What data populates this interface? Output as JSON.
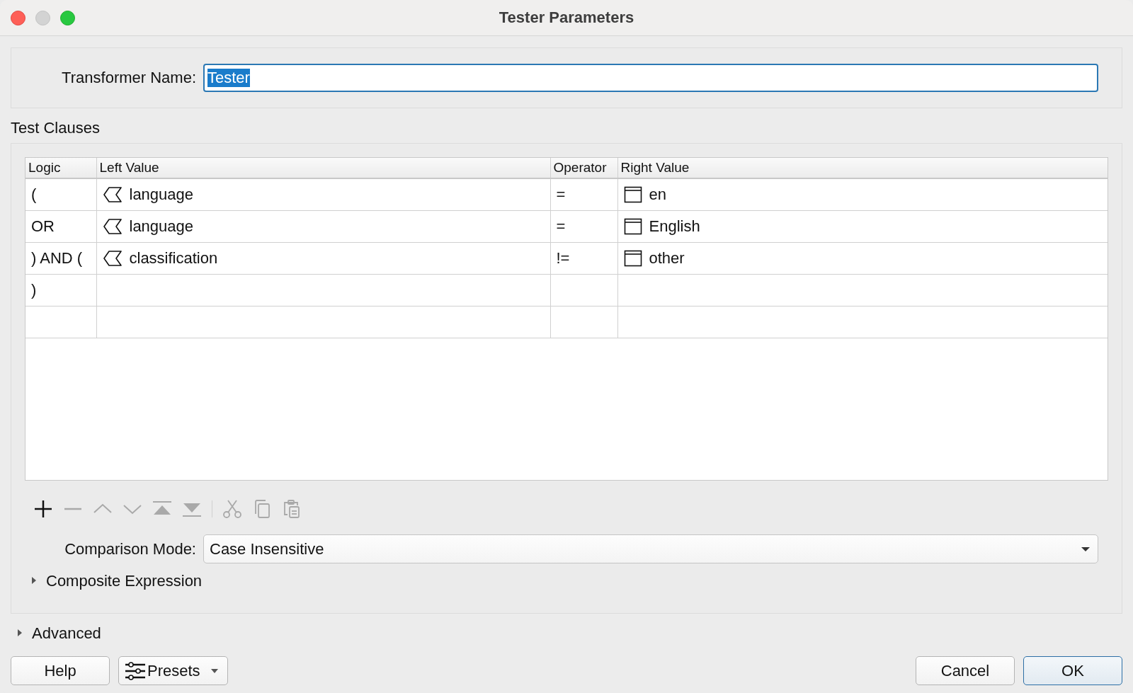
{
  "window": {
    "title": "Tester Parameters",
    "controls": [
      {
        "kind": "close",
        "disabled": false
      },
      {
        "kind": "minimize",
        "disabled": true
      },
      {
        "kind": "zoom",
        "disabled": false
      }
    ]
  },
  "transformer_name": {
    "label": "Transformer Name:",
    "value": "Tester",
    "text_selected": true
  },
  "test_clauses": {
    "title": "Test Clauses",
    "table": {
      "columns": [
        "Logic",
        "Left Value",
        "Operator",
        "Right Value"
      ],
      "rows": [
        {
          "logic": "(",
          "left": {
            "kind": "attribute",
            "text": "language"
          },
          "operator": "=",
          "right": {
            "kind": "constant",
            "text": "en"
          }
        },
        {
          "logic": "OR",
          "left": {
            "kind": "attribute",
            "text": "language"
          },
          "operator": "=",
          "right": {
            "kind": "constant",
            "text": "English"
          }
        },
        {
          "logic": ") AND (",
          "left": {
            "kind": "attribute",
            "text": "classification"
          },
          "operator": "!=",
          "right": {
            "kind": "constant",
            "text": "other"
          }
        },
        {
          "logic": ")"
        },
        {}
      ]
    },
    "toolbar": [
      {
        "kind": "add",
        "disabled": false
      },
      {
        "kind": "remove",
        "disabled": true
      },
      {
        "kind": "up",
        "disabled": true
      },
      {
        "kind": "down",
        "disabled": true
      },
      {
        "kind": "top",
        "disabled": true
      },
      {
        "kind": "bottom",
        "disabled": true
      },
      {
        "kind": "separator"
      },
      {
        "kind": "cut",
        "disabled": true
      },
      {
        "kind": "copy",
        "disabled": true
      },
      {
        "kind": "paste",
        "disabled": true
      }
    ],
    "comparison_mode": {
      "label": "Comparison Mode:",
      "value": "Case Insensitive"
    },
    "composite_expression": {
      "label": "Composite Expression",
      "expanded": false
    }
  },
  "advanced": {
    "label": "Advanced",
    "expanded": false
  },
  "footer": {
    "left_buttons": [
      {
        "kind": "plain",
        "label": "Help"
      },
      {
        "kind": "presets",
        "label": "Presets"
      }
    ],
    "right_buttons": [
      {
        "label": "Cancel",
        "default": false
      },
      {
        "label": "OK",
        "default": true
      }
    ]
  }
}
